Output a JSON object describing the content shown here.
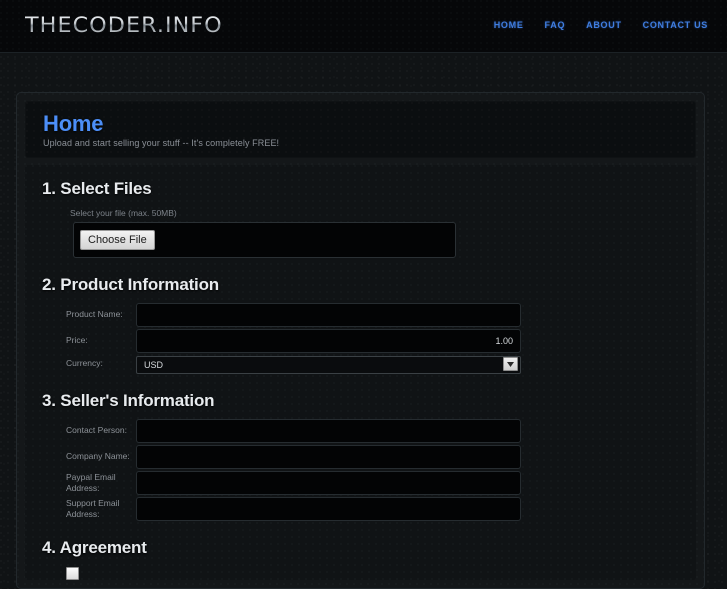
{
  "header": {
    "logo": "THECODER.INFO",
    "nav": [
      {
        "label": "HOME"
      },
      {
        "label": "FAQ"
      },
      {
        "label": "ABOUT"
      },
      {
        "label": "CONTACT US"
      }
    ]
  },
  "hero": {
    "title": "Home",
    "subtitle": "Upload and start selling your stuff -- It's completely FREE!"
  },
  "sections": {
    "select_files": {
      "title": "1. Select Files",
      "hint": "Select your file (max. 50MB)",
      "choose_file_label": "Choose File",
      "file_value": ""
    },
    "product_information": {
      "title": "2. Product Information",
      "fields": [
        {
          "label": "Product Name:",
          "value": "",
          "placeholder": ""
        },
        {
          "label": "Price:",
          "value": "1.00",
          "placeholder": ""
        },
        {
          "label": "Currency:",
          "value": "USD",
          "placeholder": ""
        }
      ]
    },
    "sellers_information": {
      "title": "3. Seller's Information",
      "fields": [
        {
          "label": "Contact Person:",
          "value": "",
          "placeholder": ""
        },
        {
          "label": "Company Name:",
          "value": "",
          "placeholder": ""
        },
        {
          "label": "Paypal Email Address:",
          "value": "",
          "placeholder": ""
        },
        {
          "label": "Support Email Address:",
          "value": "",
          "placeholder": ""
        }
      ]
    },
    "agreement": {
      "title": "4. Agreement",
      "checkbox_label": ""
    }
  },
  "colors": {
    "accent_blue": "#4c8ef7",
    "nav_blue": "#3f7de0",
    "page_bg": "#101315",
    "header_bg": "#060709"
  }
}
